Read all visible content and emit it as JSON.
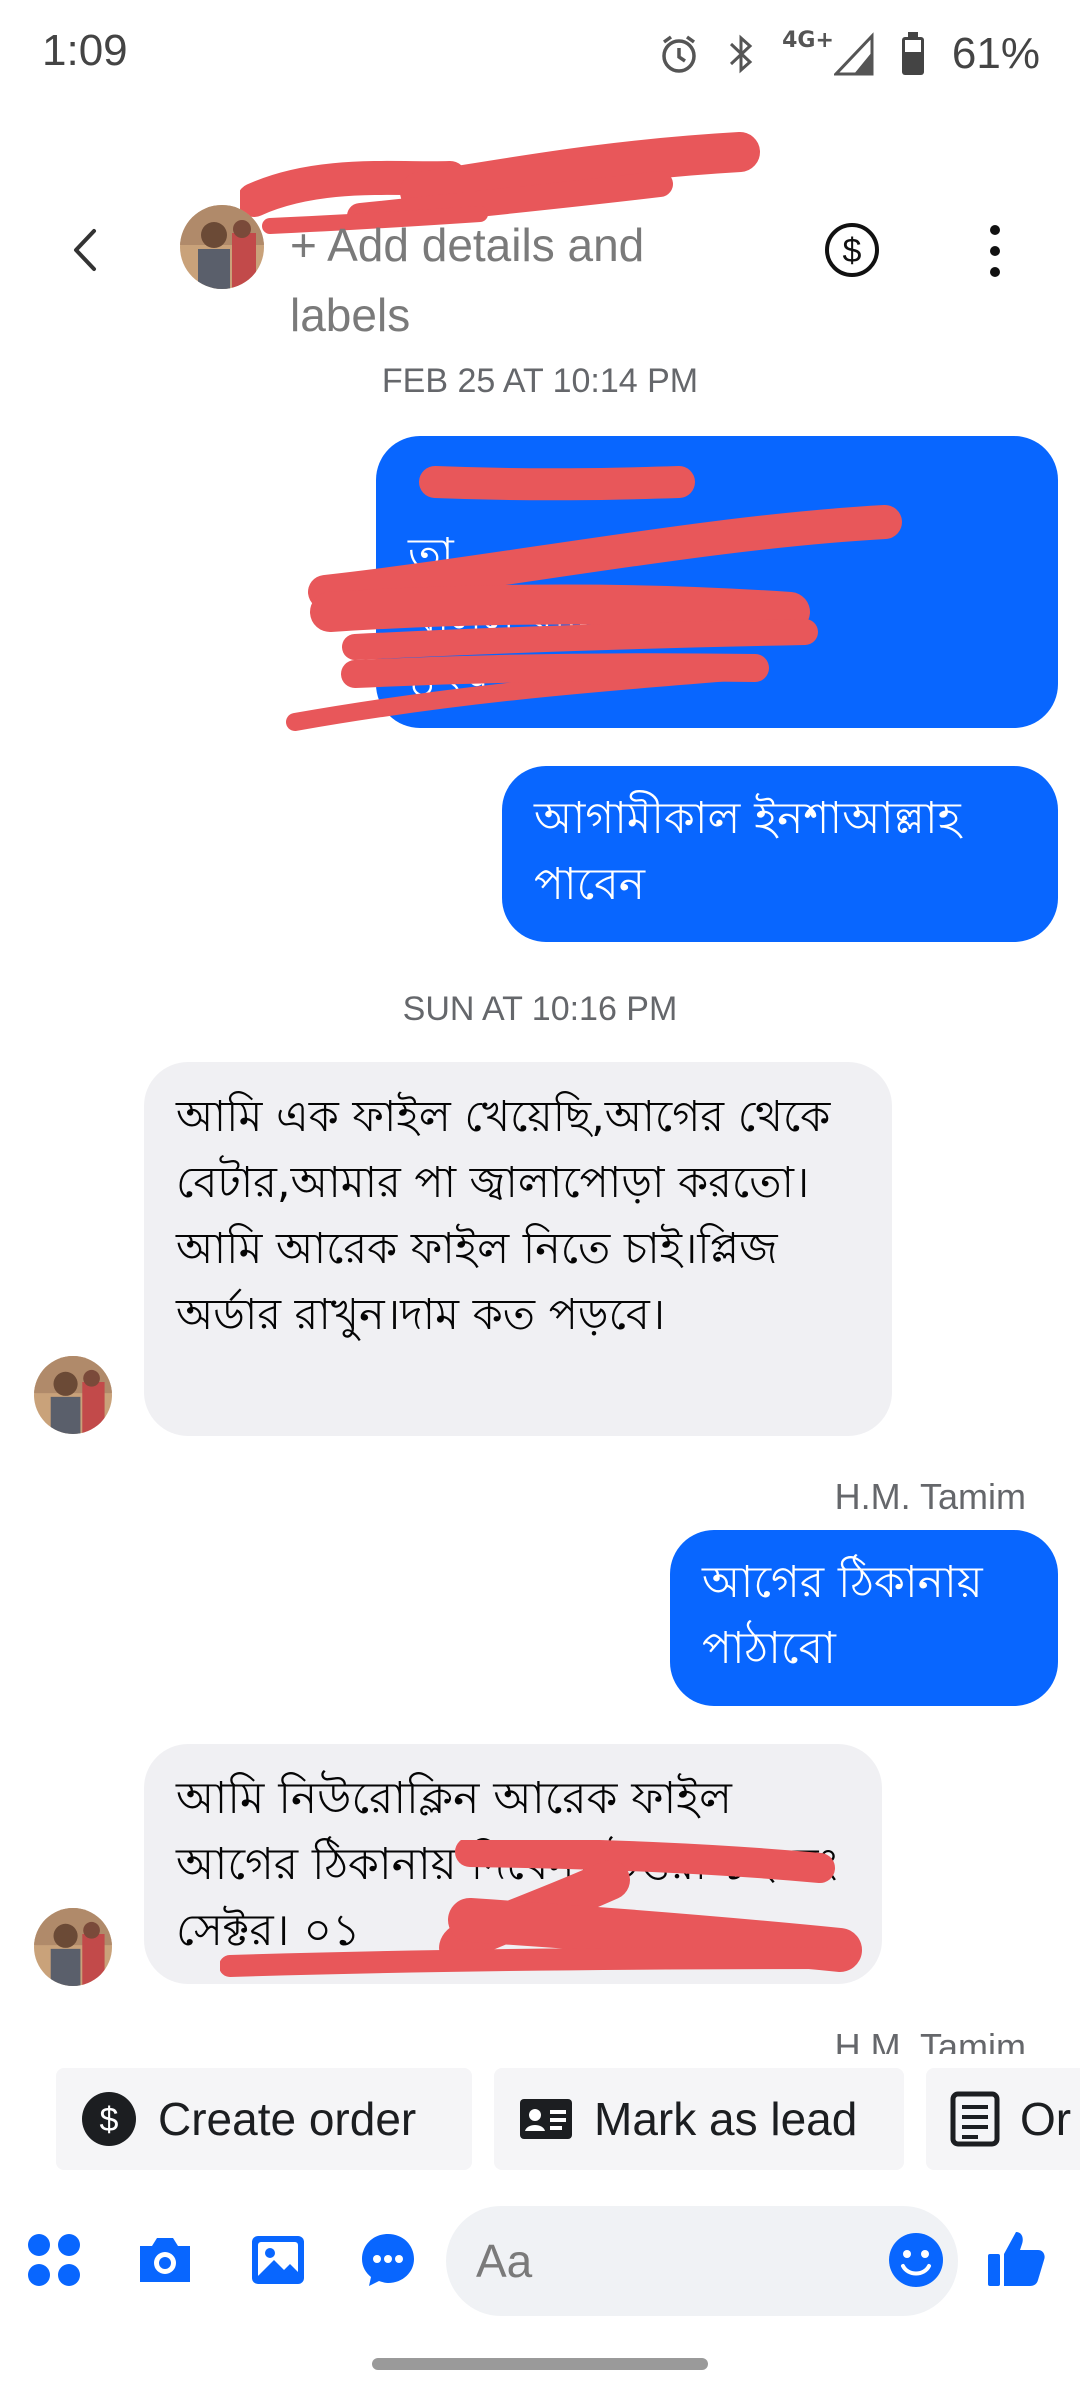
{
  "status_bar": {
    "time": "1:09",
    "network": "4G+",
    "battery": "61%"
  },
  "header": {
    "contact_name": "",
    "subtitle": "+ Add details and labels"
  },
  "messages": [
    {
      "type": "date",
      "text": "FEB 25 AT 10:14 PM"
    },
    {
      "type": "out",
      "text": "তা\nখলিল রাস্তা ১২ সেক্টর\n০১৭\n"
    },
    {
      "type": "out",
      "text": "আগামীকাল ইনশাআল্লাহ পাবেন"
    },
    {
      "type": "date",
      "text": "SUN AT 10:16 PM"
    },
    {
      "type": "in",
      "text": "আমি এক ফাইল খেয়েছি,আগের থেকে বেটার,আমার পা জ্বালাপোড়া করতো।আমি আরেক ফাইল নিতে চাই।প্লিজ অর্ডার রাখুন।দাম কত পড়বে।"
    },
    {
      "type": "sender",
      "text": "H.M. Tamim"
    },
    {
      "type": "out",
      "text": "আগের ঠিকানায় পাঠাবো"
    },
    {
      "type": "in",
      "text": "আমি  নিউরোক্লিন আরেক ফাইল আগের ঠিকানায় দিবেন। উত্তরা ১২ নং সেক্টর। ০১"
    },
    {
      "type": "sender",
      "text": "H.M. Tamim"
    }
  ],
  "quick_actions": [
    {
      "label": "Create order",
      "icon": "dollar-circle-icon"
    },
    {
      "label": "Mark as lead",
      "icon": "contact-card-icon"
    },
    {
      "label": "Or",
      "icon": "document-list-icon"
    }
  ],
  "composer": {
    "placeholder": "Aa",
    "icons": [
      "apps-grid-icon",
      "camera-icon",
      "gallery-icon",
      "chat-bubble-icon",
      "emoji-icon",
      "thumbs-up-icon"
    ]
  },
  "colors": {
    "accent": "#0866ff",
    "incoming_bubble": "#f0f0f3",
    "redaction": "#e8575a"
  }
}
